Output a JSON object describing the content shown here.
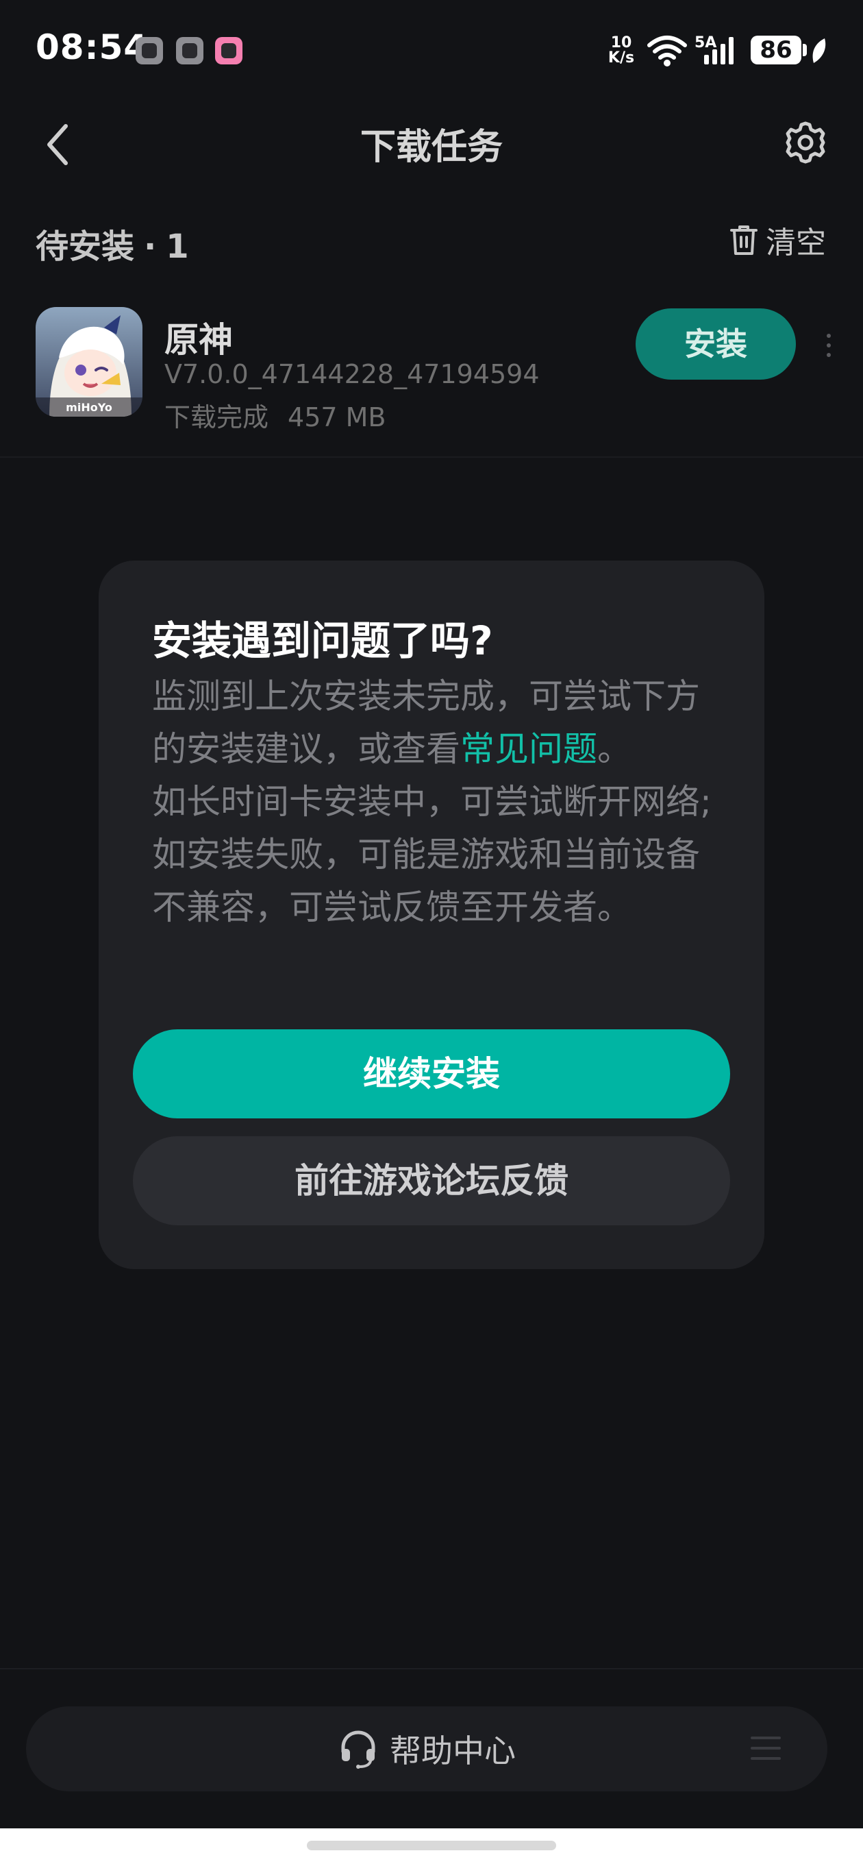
{
  "status_bar": {
    "time": "08:54",
    "net_speed_value": "10",
    "net_speed_unit": "K/s",
    "signal_label": "5A",
    "battery": "86"
  },
  "header": {
    "title": "下载任务",
    "back_icon": "chevron-left-icon",
    "settings_icon": "gear-icon"
  },
  "section": {
    "title": "待安装",
    "separator": "·",
    "count": "1",
    "clear_label": "清空"
  },
  "task": {
    "name": "原神",
    "version": "V7.0.0_47144228_47194594",
    "status": "下载完成",
    "size": "457 MB",
    "install_label": "安装",
    "icon_brand_text": "miHoYo"
  },
  "dialog": {
    "title": "安装遇到问题了吗?",
    "body_part1": "监测到上次安装未完成，可尝试下方的安装建议，或查看",
    "body_link": "常见问题",
    "body_part2": "。",
    "body_line2": "如长时间卡安装中，可尝试断开网络;",
    "body_line3": "如安装失败，可能是游戏和当前设备不兼容，可尝试反馈至开发者。",
    "primary_button": "继续安装",
    "secondary_button": "前往游戏论坛反馈"
  },
  "bottom": {
    "help_label": "帮助中心"
  },
  "colors": {
    "background": "#121316",
    "accent": "#00b5a3",
    "install_button": "#0d7f72",
    "link": "#12c0a8",
    "dialog_bg": "#202125"
  }
}
